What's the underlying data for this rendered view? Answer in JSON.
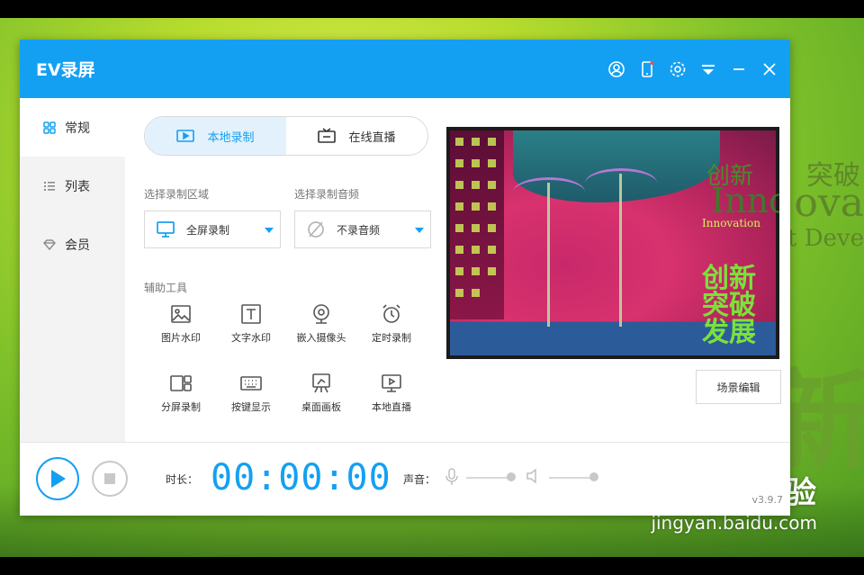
{
  "app": {
    "title": "EV录屏",
    "version": "v3.9.7",
    "accent_color": "#14a0f2"
  },
  "titlebar_icons": [
    "user-icon",
    "phone-icon",
    "settings-icon",
    "menu-icon",
    "minimize-icon",
    "close-icon"
  ],
  "sidebar": {
    "items": [
      {
        "label": "常规",
        "icon": "grid-icon",
        "active": true
      },
      {
        "label": "列表",
        "icon": "list-icon",
        "active": false
      },
      {
        "label": "会员",
        "icon": "diamond-icon",
        "active": false
      }
    ]
  },
  "tabs": [
    {
      "label": "本地录制",
      "icon": "record-icon",
      "active": true
    },
    {
      "label": "在线直播",
      "icon": "tv-icon",
      "active": false
    }
  ],
  "record_area": {
    "label": "选择录制区域",
    "value": "全屏录制"
  },
  "record_audio": {
    "label": "选择录制音频",
    "value": "不录音频"
  },
  "tools": {
    "label": "辅助工具",
    "items": [
      {
        "label": "图片水印",
        "icon": "image-icon"
      },
      {
        "label": "文字水印",
        "icon": "text-icon"
      },
      {
        "label": "嵌入摄像头",
        "icon": "webcam-icon"
      },
      {
        "label": "定时录制",
        "icon": "alarm-icon"
      },
      {
        "label": "分屏录制",
        "icon": "split-screen-icon"
      },
      {
        "label": "按键显示",
        "icon": "keyboard-icon"
      },
      {
        "label": "桌面画板",
        "icon": "easel-icon"
      },
      {
        "label": "本地直播",
        "icon": "monitor-icon"
      }
    ]
  },
  "preview": {
    "text_innov": "Innov",
    "text_innovation": "Innovation",
    "text_chuangxin": "创新",
    "text_green1": "创新",
    "text_green2": "突破",
    "text_green3": "发展"
  },
  "scene_button": "场景编辑",
  "bottom": {
    "duration_label": "时长：",
    "timer": "00:00:00",
    "sound_label": "声音："
  },
  "desktop": {
    "text1": "突破",
    "text2": "ova",
    "text3": "nt Deve",
    "text_big": "创新",
    "watermark_main": "Baidu 经验",
    "watermark_sub": "jingyan.baidu.com"
  }
}
